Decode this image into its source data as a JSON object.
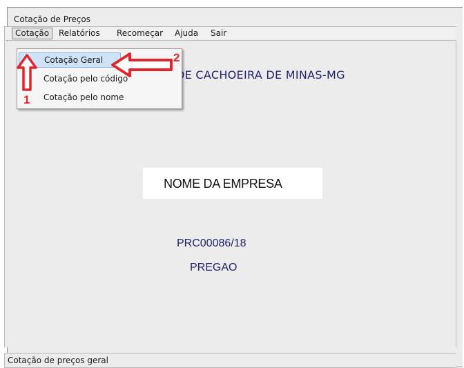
{
  "window": {
    "title": "Cotação de Preços"
  },
  "menubar": {
    "items": [
      "Cotação",
      "Relatórios",
      "Recomeçar",
      "Ajuda",
      "Sair"
    ]
  },
  "dropdown": {
    "items": [
      "Cotação Geral",
      "Cotação pelo código",
      "Cotação pelo nome"
    ]
  },
  "main": {
    "header_text": "DE CACHOEIRA DE MINAS-MG",
    "company_name": "NOME DA EMPRESA",
    "process_code": "PRC00086/18",
    "modality": "PREGAO"
  },
  "statusbar": {
    "text": "Cotação de preços geral"
  },
  "annotations": {
    "label_1": "1",
    "label_2": "2",
    "color": "#e0252c"
  },
  "colors": {
    "text_blue": "#1f1f6a",
    "highlight": "#cfe3f7"
  }
}
